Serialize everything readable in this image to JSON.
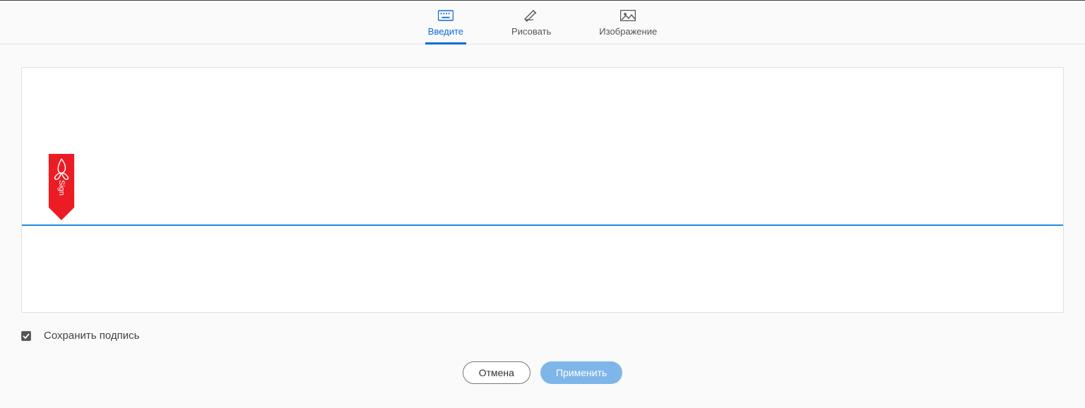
{
  "tabs": [
    {
      "id": "type",
      "label": "Введите",
      "icon": "keyboard-icon",
      "active": true
    },
    {
      "id": "draw",
      "label": "Рисовать",
      "icon": "pen-icon",
      "active": false
    },
    {
      "id": "image",
      "label": "Изображение",
      "icon": "image-icon",
      "active": false
    }
  ],
  "sign_tag": {
    "label": "Sign"
  },
  "save_signature": {
    "checked": true,
    "label": "Сохранить подпись"
  },
  "buttons": {
    "cancel": "Отмена",
    "apply": "Применить"
  }
}
